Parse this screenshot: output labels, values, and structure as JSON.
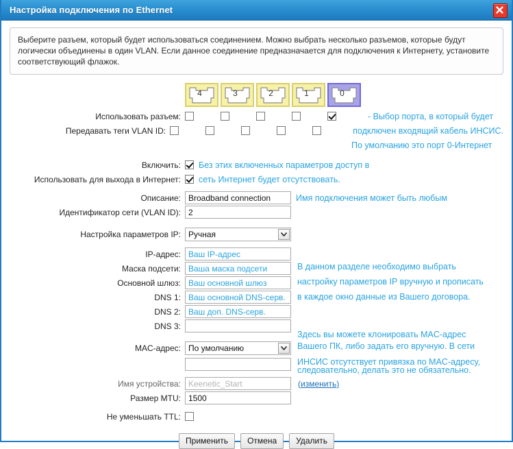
{
  "window": {
    "title": "Настройка подключения по Ethernet",
    "close_icon": "close-icon"
  },
  "info": {
    "text": "Выберите разъем, который будет использоваться соединением. Можно выбрать несколько разъемов, которые будут логически объединены в один VLAN. Если данное соединение предназначается для подключения к Интернету, установите соответствующий флажок."
  },
  "ports": [
    {
      "label": "4",
      "selected": false
    },
    {
      "label": "3",
      "selected": false
    },
    {
      "label": "2",
      "selected": false
    },
    {
      "label": "1",
      "selected": false
    },
    {
      "label": "0",
      "selected": true
    }
  ],
  "port_rows": [
    {
      "label": "Использовать разъем:",
      "checked": [
        false,
        false,
        false,
        false,
        true
      ]
    },
    {
      "label": "Передавать теги VLAN ID:",
      "checked": [
        false,
        false,
        false,
        false,
        false
      ]
    }
  ],
  "notes": {
    "port_note_line1": "- Выбор порта, в который будет",
    "port_note_line2": "подключен входящий кабель ИНСИС.",
    "port_note_line3": "По умолчанию это порт 0-Интернет",
    "enable_note_line1": "Без этих включенных параметров доступ в",
    "enable_note_line2": "сеть Интернет будет отсутствовать.",
    "description_note": "Имя подключения может быть любым",
    "ip_note_line1": "В данном разделе необходимо выбрать",
    "ip_note_line2": "настройку параметров IP вручную и прописать",
    "ip_note_line3": "в каждое окно данные из Вашего договора.",
    "mac_note_line1": "Здесь вы можете клонировать MAC-адрес",
    "mac_note_line2": "Вашего ПК, либо задать его вручную. В сети",
    "mac_note_line3": "ИНСИС отсутствует привязка по MAC-адресу,",
    "mac_note_line4": "следовательно, делать это не обязательно."
  },
  "fields": {
    "enable": {
      "label": "Включить:",
      "checked": true
    },
    "use_for_internet": {
      "label": "Использовать для выхода в Интернет:",
      "checked": true
    },
    "description": {
      "label": "Описание:",
      "value": "Broadband connection"
    },
    "vlan_id": {
      "label": "Идентификатор сети (VLAN ID):",
      "value": "2"
    },
    "ip_settings": {
      "label": "Настройка параметров IP:",
      "value": "Ручная"
    },
    "ip_address": {
      "label": "IP-адрес:",
      "value": "Ваш IP-адрес"
    },
    "subnet_mask": {
      "label": "Маска подсети:",
      "value": "Ваша маска подсети"
    },
    "gateway": {
      "label": "Основной шлюз:",
      "value": "Ваш основной шлюз"
    },
    "dns1": {
      "label": "DNS 1:",
      "value": "Ваш основной DNS-серв."
    },
    "dns2": {
      "label": "DNS 2:",
      "value": "Ваш доп. DNS-серв."
    },
    "dns3": {
      "label": "DNS 3:",
      "value": ""
    },
    "mac_address": {
      "label": "MAC-адрес:",
      "value": "По умолчанию"
    },
    "mac_manual": {
      "label": "",
      "value": ""
    },
    "device_name": {
      "label": "Имя устройства:",
      "value": "Keenetic_Start",
      "change_link": "(изменить)"
    },
    "mtu": {
      "label": "Размер MTU:",
      "value": "1500"
    },
    "no_ttl_decrement": {
      "label": "Не уменьшать TTL:",
      "checked": false
    }
  },
  "buttons": {
    "apply": "Применить",
    "cancel": "Отмена",
    "delete": "Удалить"
  },
  "colors": {
    "accent_blue": "#29a3e0",
    "title_blue": "#2a8fd0",
    "port_yellow": "#f7f2a8",
    "port_selected": "#a9a4e8",
    "close_red": "#e8392a"
  }
}
